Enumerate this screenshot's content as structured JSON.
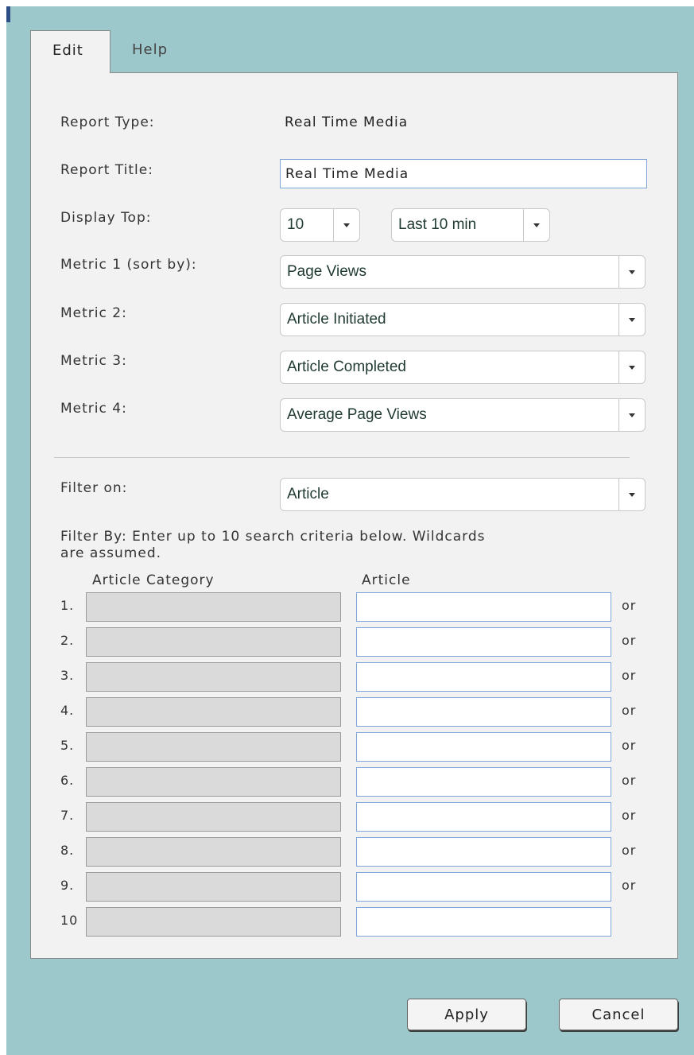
{
  "tabs": [
    {
      "label": "Edit",
      "active": true
    },
    {
      "label": "Help",
      "active": false
    }
  ],
  "form": {
    "report_type_label": "Report Type:",
    "report_type_value": "Real Time Media",
    "report_title_label": "Report Title:",
    "report_title_value": "Real Time Media",
    "display_top_label": "Display Top:",
    "display_top_count": "10",
    "display_top_period": "Last 10 min",
    "metric1_label": "Metric 1 (sort by):",
    "metric1_value": "Page Views",
    "metric2_label": "Metric 2:",
    "metric2_value": "Article Initiated",
    "metric3_label": "Metric 3:",
    "metric3_value": "Article Completed",
    "metric4_label": "Metric 4:",
    "metric4_value": "Average Page Views",
    "filter_on_label": "Filter on:",
    "filter_on_value": "Article"
  },
  "filter": {
    "instructions_line1": "Filter By: Enter up to 10 search criteria below. Wildcards",
    "instructions_line2": "are assumed.",
    "col_category": "Article Category",
    "col_article": "Article",
    "rows": [
      {
        "num": "1.",
        "or": "or"
      },
      {
        "num": "2.",
        "or": "or"
      },
      {
        "num": "3.",
        "or": "or"
      },
      {
        "num": "4.",
        "or": "or"
      },
      {
        "num": "5.",
        "or": "or"
      },
      {
        "num": "6.",
        "or": "or"
      },
      {
        "num": "7.",
        "or": "or"
      },
      {
        "num": "8.",
        "or": "or"
      },
      {
        "num": "9.",
        "or": "or"
      },
      {
        "num": "10",
        "or": ""
      }
    ]
  },
  "buttons": {
    "apply": "Apply",
    "cancel": "Cancel"
  },
  "colors": {
    "frame_background": "#9cc8cb",
    "panel_background": "#f2f2f2",
    "input_border": "#7ea6d9"
  }
}
